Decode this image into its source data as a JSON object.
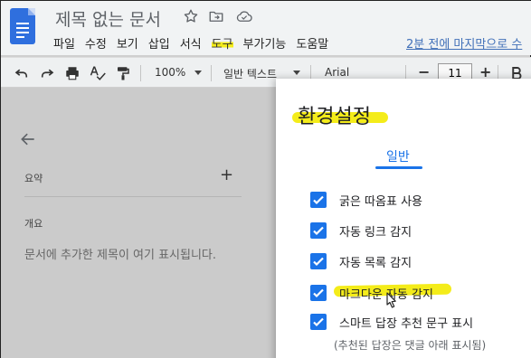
{
  "app": {
    "doc_title": "제목 없는 문서",
    "menu": [
      "파일",
      "수정",
      "보기",
      "삽입",
      "서식",
      "도구",
      "부가기능",
      "도움말"
    ],
    "highlighted_menu": "도구",
    "last_edit": "2분 전에 마지막으로 수"
  },
  "toolbar": {
    "zoom": "100%",
    "style": "일반 텍스트",
    "font": "Arial",
    "font_size": "11",
    "minus": "−",
    "plus": "+"
  },
  "outline": {
    "summary_label": "요약",
    "add_symbol": "+",
    "outline_label": "개요",
    "hint": "문서에 추가한 제목이 여기 표시됩니다."
  },
  "dialog": {
    "title": "환경설정",
    "tab": "일반",
    "options": [
      {
        "label": "굵은 따옴표 사용",
        "checked": true
      },
      {
        "label": "자동 링크 감지",
        "checked": true
      },
      {
        "label": "자동 목록 감지",
        "checked": true
      },
      {
        "label": "마크다운 자동 감지",
        "checked": true
      },
      {
        "label": "스마트 답장 추천 문구 표시",
        "checked": true
      }
    ],
    "sub_note": "(추천된 답장은 댓글 아래 표시됨)"
  },
  "colors": {
    "accent": "#1a73e8",
    "highlight": "#f4ec1a",
    "doc_icon": "#2f6fde",
    "link": "#4170b8"
  }
}
